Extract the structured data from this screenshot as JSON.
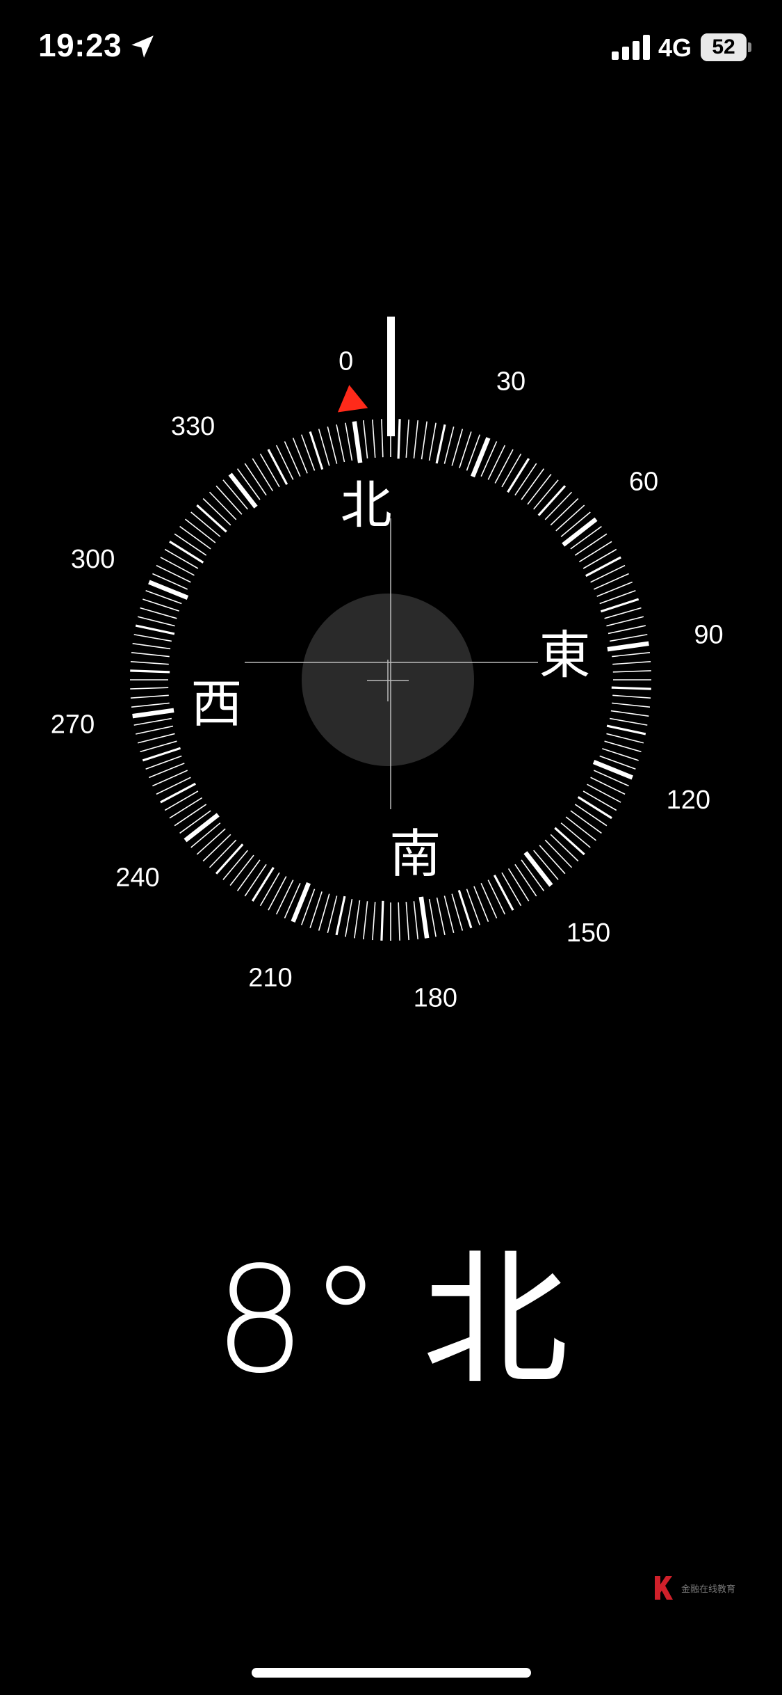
{
  "status_bar": {
    "time": "19:23",
    "location_icon": "location-arrow-icon",
    "signal_icon": "cellular-signal-icon",
    "signal_bars": 4,
    "network": "4G",
    "battery_percent": "52",
    "battery_level": 0.52
  },
  "compass": {
    "heading_degrees": 8,
    "degree_labels": [
      "0",
      "30",
      "60",
      "90",
      "120",
      "150",
      "180",
      "210",
      "240",
      "270",
      "300",
      "330"
    ],
    "cardinals": {
      "north": "北",
      "east": "東",
      "south": "南",
      "west": "西"
    },
    "marker_color": "#ff2a1a",
    "ring_color": "#ffffff",
    "center_disc_color": "#2a2a2a"
  },
  "readout": {
    "degree": "8°",
    "direction": "北"
  },
  "watermark": {
    "text": "金融在线教育",
    "logo_color": "#d0202a"
  }
}
